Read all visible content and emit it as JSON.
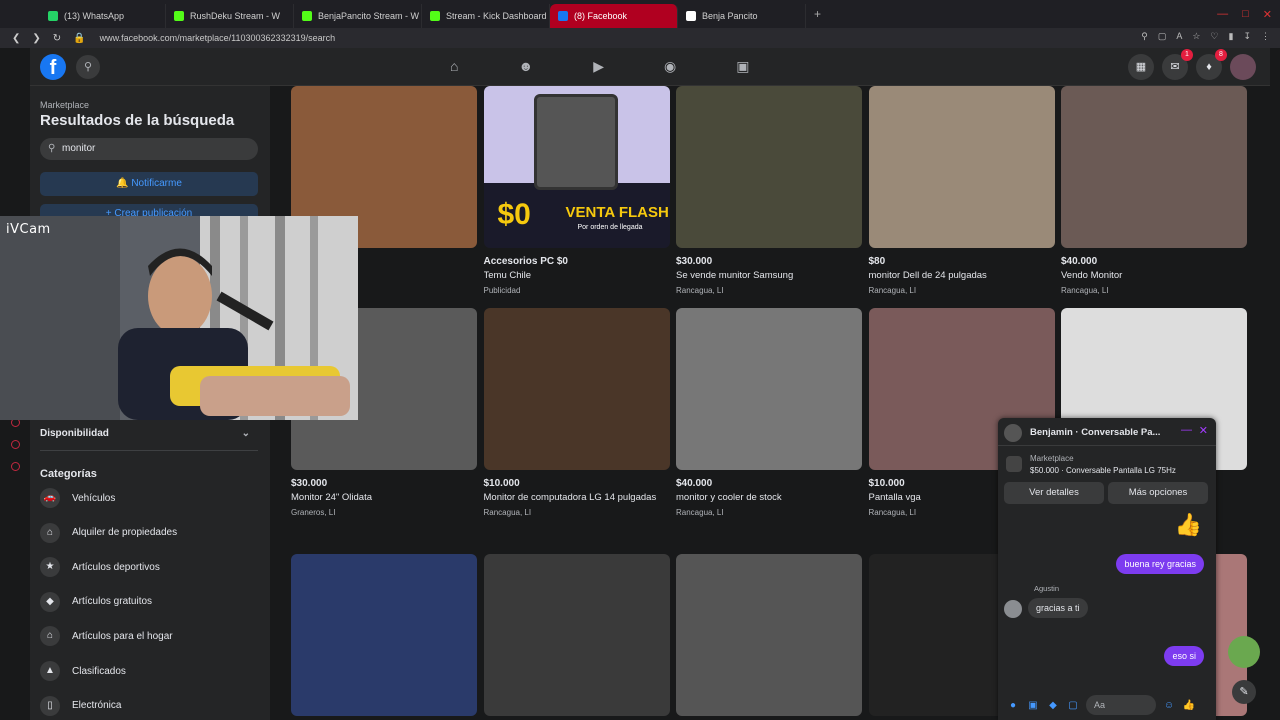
{
  "browser": {
    "tabs": [
      {
        "label": "(13) WhatsApp",
        "color": "#25d366",
        "active": false
      },
      {
        "label": "RushDeku Stream - W",
        "color": "#53fc18",
        "active": false
      },
      {
        "label": "BenjaPancito Stream - W",
        "color": "#53fc18",
        "active": false
      },
      {
        "label": "Stream - Kick Dashboard",
        "color": "#53fc18",
        "active": false
      },
      {
        "label": "(8) Facebook",
        "color": "#1877f2",
        "active": true
      },
      {
        "label": "Benja Pancito",
        "color": "#ffffff",
        "active": false
      }
    ],
    "new_tab": "+",
    "url": "www.facebook.com/marketplace/110300362332319/search"
  },
  "header": {
    "logo": "f",
    "notifications_badge": "8",
    "messenger_badge": "1"
  },
  "sidebar": {
    "section": "Marketplace",
    "title": "Resultados de la búsqueda",
    "search_value": "monitor",
    "notify_label": "Notificarme",
    "create_label": "+ Crear publicación",
    "availability_label": "Disponibilidad",
    "categories_title": "Categorías",
    "categories": [
      {
        "label": "Vehículos",
        "icon": "car-icon"
      },
      {
        "label": "Alquiler de propiedades",
        "icon": "house-key-icon"
      },
      {
        "label": "Artículos deportivos",
        "icon": "runner-icon"
      },
      {
        "label": "Artículos gratuitos",
        "icon": "tag-icon"
      },
      {
        "label": "Artículos para el hogar",
        "icon": "home-icon"
      },
      {
        "label": "Clasificados",
        "icon": "megaphone-icon"
      },
      {
        "label": "Electrónica",
        "icon": "phone-icon"
      }
    ]
  },
  "webcam": {
    "label": "iVCam"
  },
  "listings": {
    "row1": [
      {
        "price": "",
        "title": "",
        "location": "",
        "color": "#8a5a3a"
      },
      {
        "price": "Accesorios PC $0",
        "title": "Temu Chile",
        "location": "Publicidad",
        "color": "#c9c3e8",
        "ad_big": "$0",
        "ad_text": "VENTA FLASH",
        "ad_sub": "Por orden de llegada"
      },
      {
        "price": "$30.000",
        "title": "Se vende munitor Samsung",
        "location": "Rancagua, LI",
        "color": "#4a4a3a"
      },
      {
        "price": "$80",
        "title": "monitor Dell de 24 pulgadas",
        "location": "Rancagua, LI",
        "color": "#9a8a78"
      },
      {
        "price": "$40.000",
        "title": "Vendo Monitor",
        "location": "Rancagua, LI",
        "color": "#6b5a55"
      }
    ],
    "row2": [
      {
        "price": "$30.000",
        "title": "Monitor 24\" Olidata",
        "location": "Graneros, LI",
        "color": "#5a5a5a"
      },
      {
        "price": "$10.000",
        "title": "Monitor de computadora LG 14 pulgadas",
        "location": "Rancagua, LI",
        "color": "#4a3628"
      },
      {
        "price": "$40.000",
        "title": "monitor y cooler de stock",
        "location": "Rancagua, LI",
        "color": "#777"
      },
      {
        "price": "$10.000",
        "title": "Pantalla vga",
        "location": "Rancagua, LI",
        "color": "#7a5a5a"
      },
      {
        "price": "",
        "title": "",
        "location": "",
        "color": "#ddd"
      }
    ],
    "row3": [
      {
        "color": "#2a3a6a"
      },
      {
        "color": "#3a3a3a"
      },
      {
        "color": "#555"
      },
      {
        "color": "#222"
      },
      {
        "color": "#a77"
      }
    ]
  },
  "chat": {
    "name": "Benjamin · Conversable Pa...",
    "marketplace_label": "Marketplace",
    "item": "$50.000 · Conversable Pantalla LG 75Hz",
    "details_btn": "Ver detalles",
    "options_btn": "Más opciones",
    "msg1": "buena rey gracias",
    "sender": "Agustin",
    "msg2": "gracias a ti",
    "msg3": "eso si",
    "input_placeholder": "Aa"
  }
}
